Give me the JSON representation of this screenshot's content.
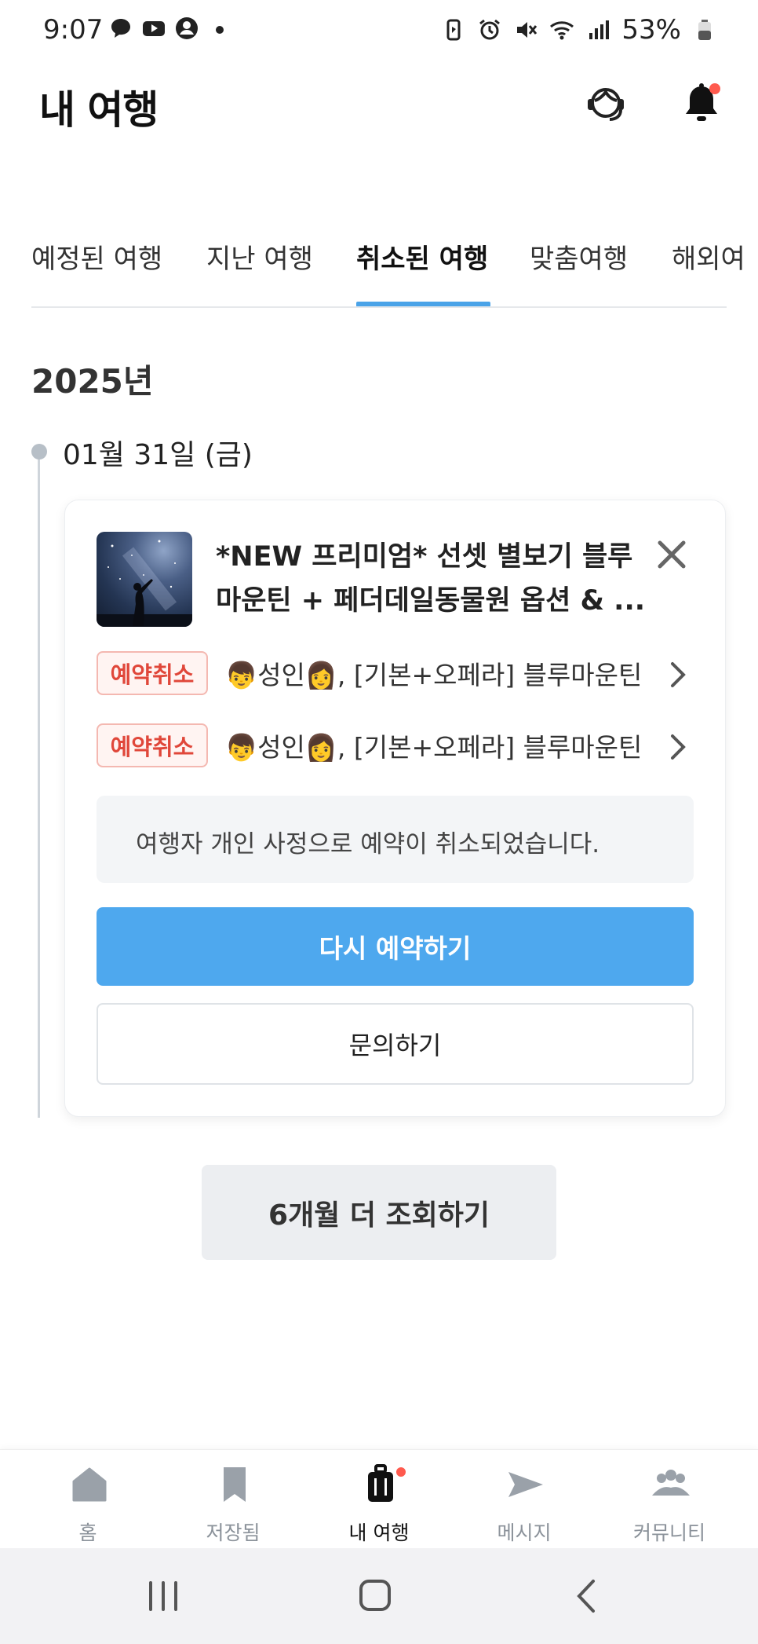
{
  "status_bar": {
    "time": "9:07",
    "battery": "53%",
    "left_icons": [
      "talk-icon",
      "youtube-icon",
      "account-icon",
      "dot-icon"
    ],
    "right_icons": [
      "battery-saver-icon",
      "alarm-icon",
      "mute-icon",
      "wifi-icon",
      "signal-icon",
      "battery-icon"
    ]
  },
  "header": {
    "title": "내 여행"
  },
  "tabs": [
    {
      "label": "예정된 여행",
      "active": false
    },
    {
      "label": "지난 여행",
      "active": false
    },
    {
      "label": "취소된 여행",
      "active": true
    },
    {
      "label": "맞춤여행",
      "active": false
    },
    {
      "label": "해외여",
      "active": false
    }
  ],
  "timeline": {
    "year": "2025년",
    "date": "01월 31일 (금)"
  },
  "booking": {
    "title": "*NEW 프리미엄* 선셋 별보기 블루 마운틴 + 페더데일동물원 옵션 & ...",
    "options": [
      {
        "badge": "예약취소",
        "text": "👦성인👩, [기본+오페라] 블루마운틴"
      },
      {
        "badge": "예약취소",
        "text": "👦성인👩, [기본+오페라] 블루마운틴"
      }
    ],
    "notice": "여행자 개인 사정으로 예약이 취소되었습니다.",
    "rebook_label": "다시 예약하기",
    "inquiry_label": "문의하기"
  },
  "more_label": "6개월 더 조회하기",
  "bottom_nav": [
    {
      "label": "홈",
      "icon": "home-icon",
      "active": false
    },
    {
      "label": "저장됨",
      "icon": "bookmark-icon",
      "active": false
    },
    {
      "label": "내 여행",
      "icon": "luggage-icon",
      "active": true
    },
    {
      "label": "메시지",
      "icon": "send-icon",
      "active": false
    },
    {
      "label": "커뮤니티",
      "icon": "community-icon",
      "active": false
    }
  ],
  "colors": {
    "accent": "#4ea8ee",
    "cancel_badge": "#e0473a",
    "notification_dot": "#ff5a4e"
  }
}
